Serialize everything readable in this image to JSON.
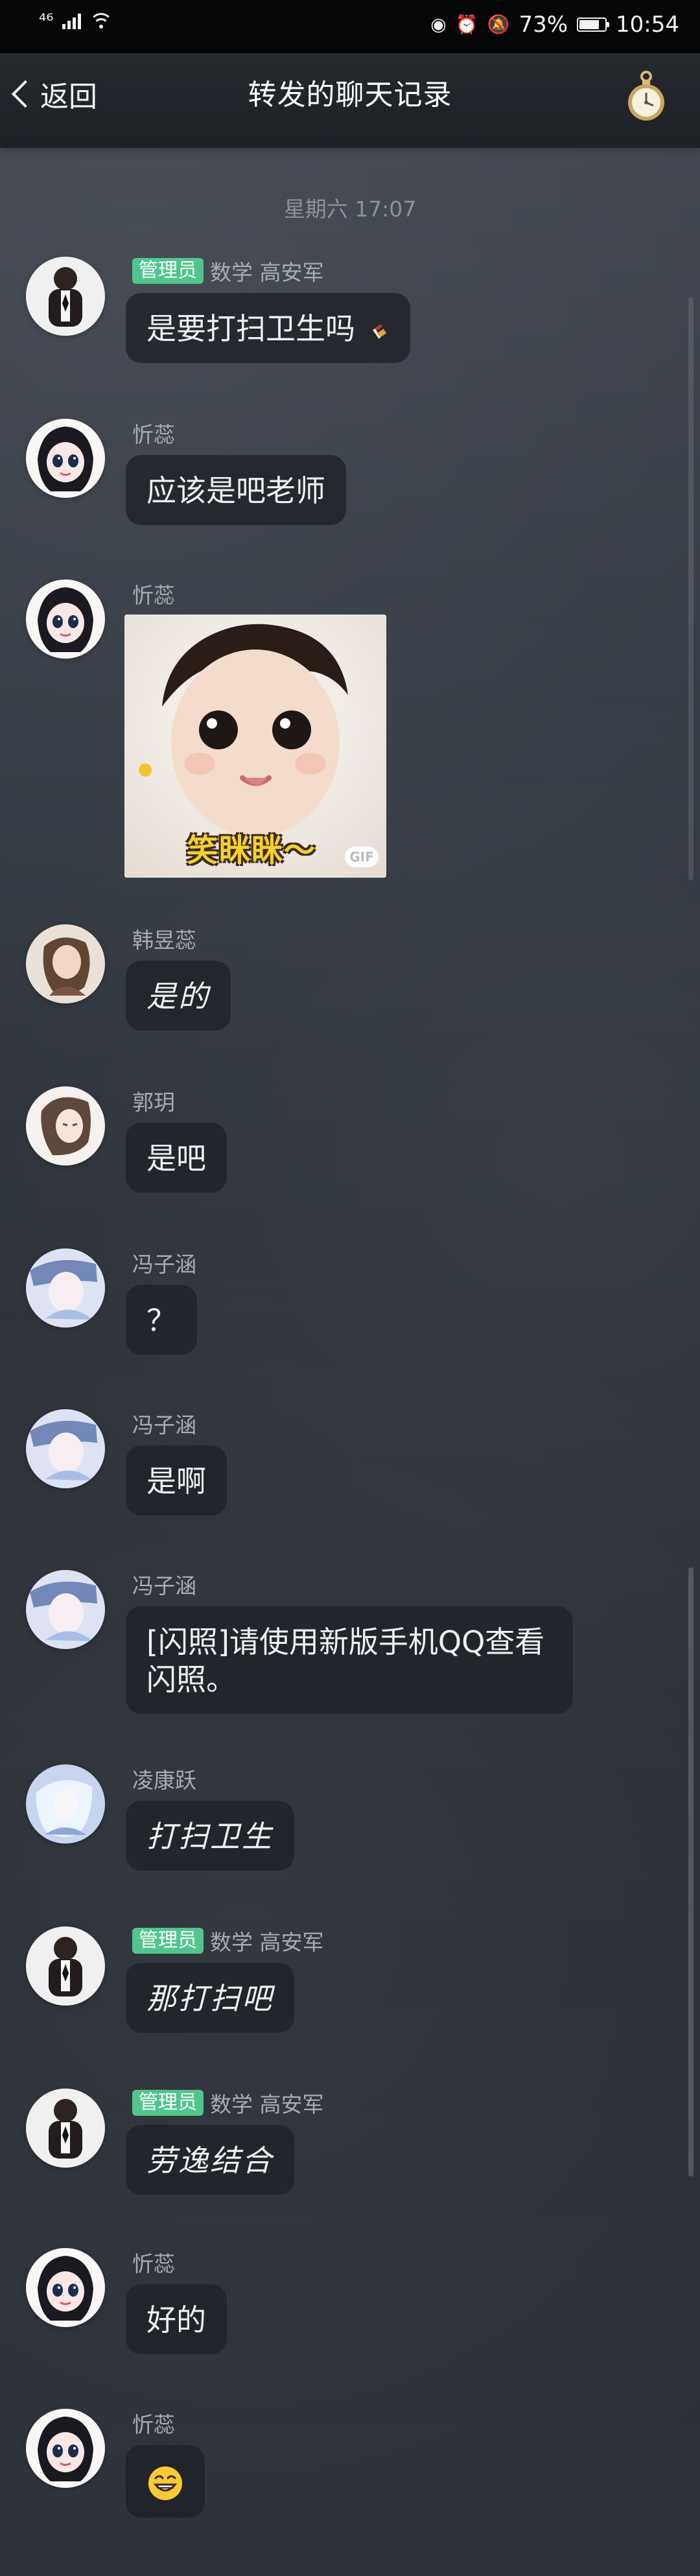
{
  "status_bar": {
    "signal_text": "⁴⁶",
    "battery_level": "73%",
    "time": "10:54"
  },
  "header": {
    "back_label": "返回",
    "title": "转发的聊天记录"
  },
  "chat": {
    "date_label": "星期六 17:07",
    "messages": [
      {
        "badge": "管理员",
        "sender": "数学  高安军",
        "text": "是要打扫卫生吗"
      },
      {
        "sender": "忻蕊",
        "text": "应该是吧老师"
      },
      {
        "sender": "忻蕊",
        "image_caption": "笑眯眯～",
        "image_badge": "GIF"
      },
      {
        "sender": "韩昱蕊",
        "text": "是的"
      },
      {
        "sender": "郭玥",
        "text": "是吧"
      },
      {
        "sender": "冯子涵",
        "text": "？"
      },
      {
        "sender": "冯子涵",
        "text": "是啊"
      },
      {
        "sender": "冯子涵",
        "text": "[闪照]请使用新版手机QQ查看闪照。"
      },
      {
        "sender": "凌康跃",
        "text": "打扫卫生"
      },
      {
        "badge": "管理员",
        "sender": "数学  高安军",
        "text": "那打扫吧"
      },
      {
        "badge": "管理员",
        "sender": "数学  高安军",
        "text": "劳逸结合"
      },
      {
        "sender": "忻蕊",
        "text": "好的"
      },
      {
        "sender": "忻蕊",
        "emoji": "grinning-face-icon"
      }
    ]
  },
  "colors": {
    "admin_badge": "#50c68c",
    "bubble": "#1e2228",
    "background_top": "#41464f",
    "background_bottom": "#2e3239"
  }
}
